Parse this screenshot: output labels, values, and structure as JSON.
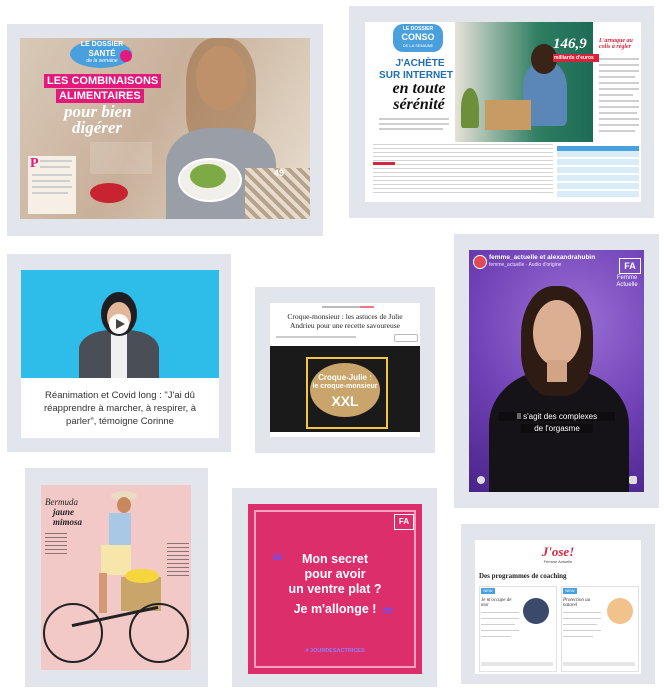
{
  "health": {
    "kicker_1": "LE DOSSIER",
    "kicker_2": "SANTÉ",
    "kicker_3": "de la semaine",
    "title_1": "LES COMBINAISONS",
    "title_2": "ALIMENTAIRES",
    "title_3": "pour bien",
    "title_4": "digérer",
    "drop_cap": "P",
    "page_num": "49"
  },
  "conso": {
    "kicker_1": "LE DOSSIER",
    "kicker_2": "CONSO",
    "kicker_3": "DE LA SEMAINE",
    "title_1": "J'ACHÈTE",
    "title_2": "SUR INTERNET",
    "title_3": "en toute",
    "title_4": "sérénité",
    "stat_value": "146,9",
    "stat_unit": "milliards d'euros",
    "side_title": "L'arnaque au colis à régler"
  },
  "video": {
    "caption": "Réanimation et Covid long : \"J'ai dû réapprendre à marcher, à respirer, à parler\", témoigne Corinne"
  },
  "article": {
    "title": "Croque-monsieur : les astuces de Julie Andrieu pour une recette savoureuse",
    "overlay_1": "Croque-Julie :",
    "overlay_2": "le croque-monsieur",
    "overlay_3": "XXL"
  },
  "insta": {
    "accounts": "femme_actuelle et alexandrahubin",
    "subline": "femme_actuelle · Audio d'origine",
    "brand_short": "FA",
    "brand_1": "Femme",
    "brand_2": "Actuelle",
    "subtitle_1": "Il s'agit des complexes",
    "subtitle_2": "de l'orgasme"
  },
  "fashion": {
    "title_1": "Bermuda",
    "title_2": "jaune",
    "title_3": "mimosa"
  },
  "quote": {
    "brand_short": "FA",
    "line_1": "Mon secret",
    "line_2": "pour avoir",
    "line_3": "un ventre plat ?",
    "line_4": "Je m'allonge !",
    "hashtag": "# JOURDESACTRICES"
  },
  "coaching": {
    "logo": "J'ose!",
    "logo_sub": "Femme Actuelle",
    "heading": "Des programmes de coaching",
    "badge_left": "NEW",
    "badge_right": "NEW",
    "left_title": "Je m'occupe de moi",
    "right_title": "Protection au naturel"
  },
  "colors": {
    "health_pink": "#e4197c",
    "conso_blue": "#4aa0dc",
    "quote_bg": "#dd2e6c",
    "quote_accent": "#6a4ff5",
    "insta_purple": "#6d3fb3",
    "coaching_red": "#d6243b"
  }
}
